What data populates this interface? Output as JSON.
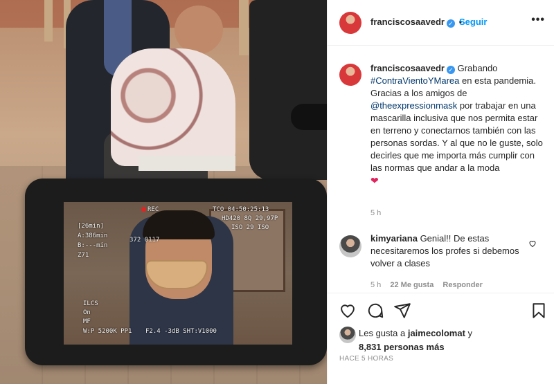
{
  "post": {
    "author": "franciscosaavedr",
    "verified_mark": "✓",
    "follow_label": "Seguir",
    "more_label": "•••"
  },
  "caption": {
    "author": "franciscosaavedr",
    "part1": "Grabando ",
    "hashtag": "#ContraVientoYMarea",
    "part2": " en esta pandemia. Gracias a los amigos de ",
    "mention": "@theexpressionmask",
    "part3": " por trabajar en una mascarilla inclusiva que nos permita estar en terreno y conectarnos también con las personas sordas. Y al que no le guste, solo decirles que me importa más cumplir con las normas que andar a la moda",
    "emoji": "❤",
    "time": "5 h"
  },
  "comment": {
    "author": "kimyariana",
    "text": "Genial!! De estas necesitaremos los profes si debemos volver a clases",
    "time": "5 h",
    "likes": "22 Me gusta",
    "reply_label": "Responder"
  },
  "likes": {
    "prefix": "Les gusta a ",
    "user": "jaimecolomat",
    "suffix": " y",
    "count_text": "8,831 personas más"
  },
  "posted_ago": "HACE 5 HORAS",
  "camera_osd": {
    "rec": "REC",
    "tc": "TCO 04:50:25:13",
    "format": "HD420 8Q 29,97P",
    "iso": "ISO 29 ISO",
    "left1": "[26min]",
    "left2": "A:386min",
    "left3": "B:---min",
    "left4": "Z71",
    "counter": "372 0117",
    "bottom1": "ILCS",
    "bottom2": "On",
    "bottom3": "MF",
    "bottom4": "W:P 5200K PP1",
    "bottom5": "F2.4 -3dB SHT:V1000"
  },
  "colors": {
    "accent": "#0095f6",
    "text": "#262626",
    "muted": "#8e8e8e",
    "link": "#00376b",
    "heart": "#e0245e"
  }
}
